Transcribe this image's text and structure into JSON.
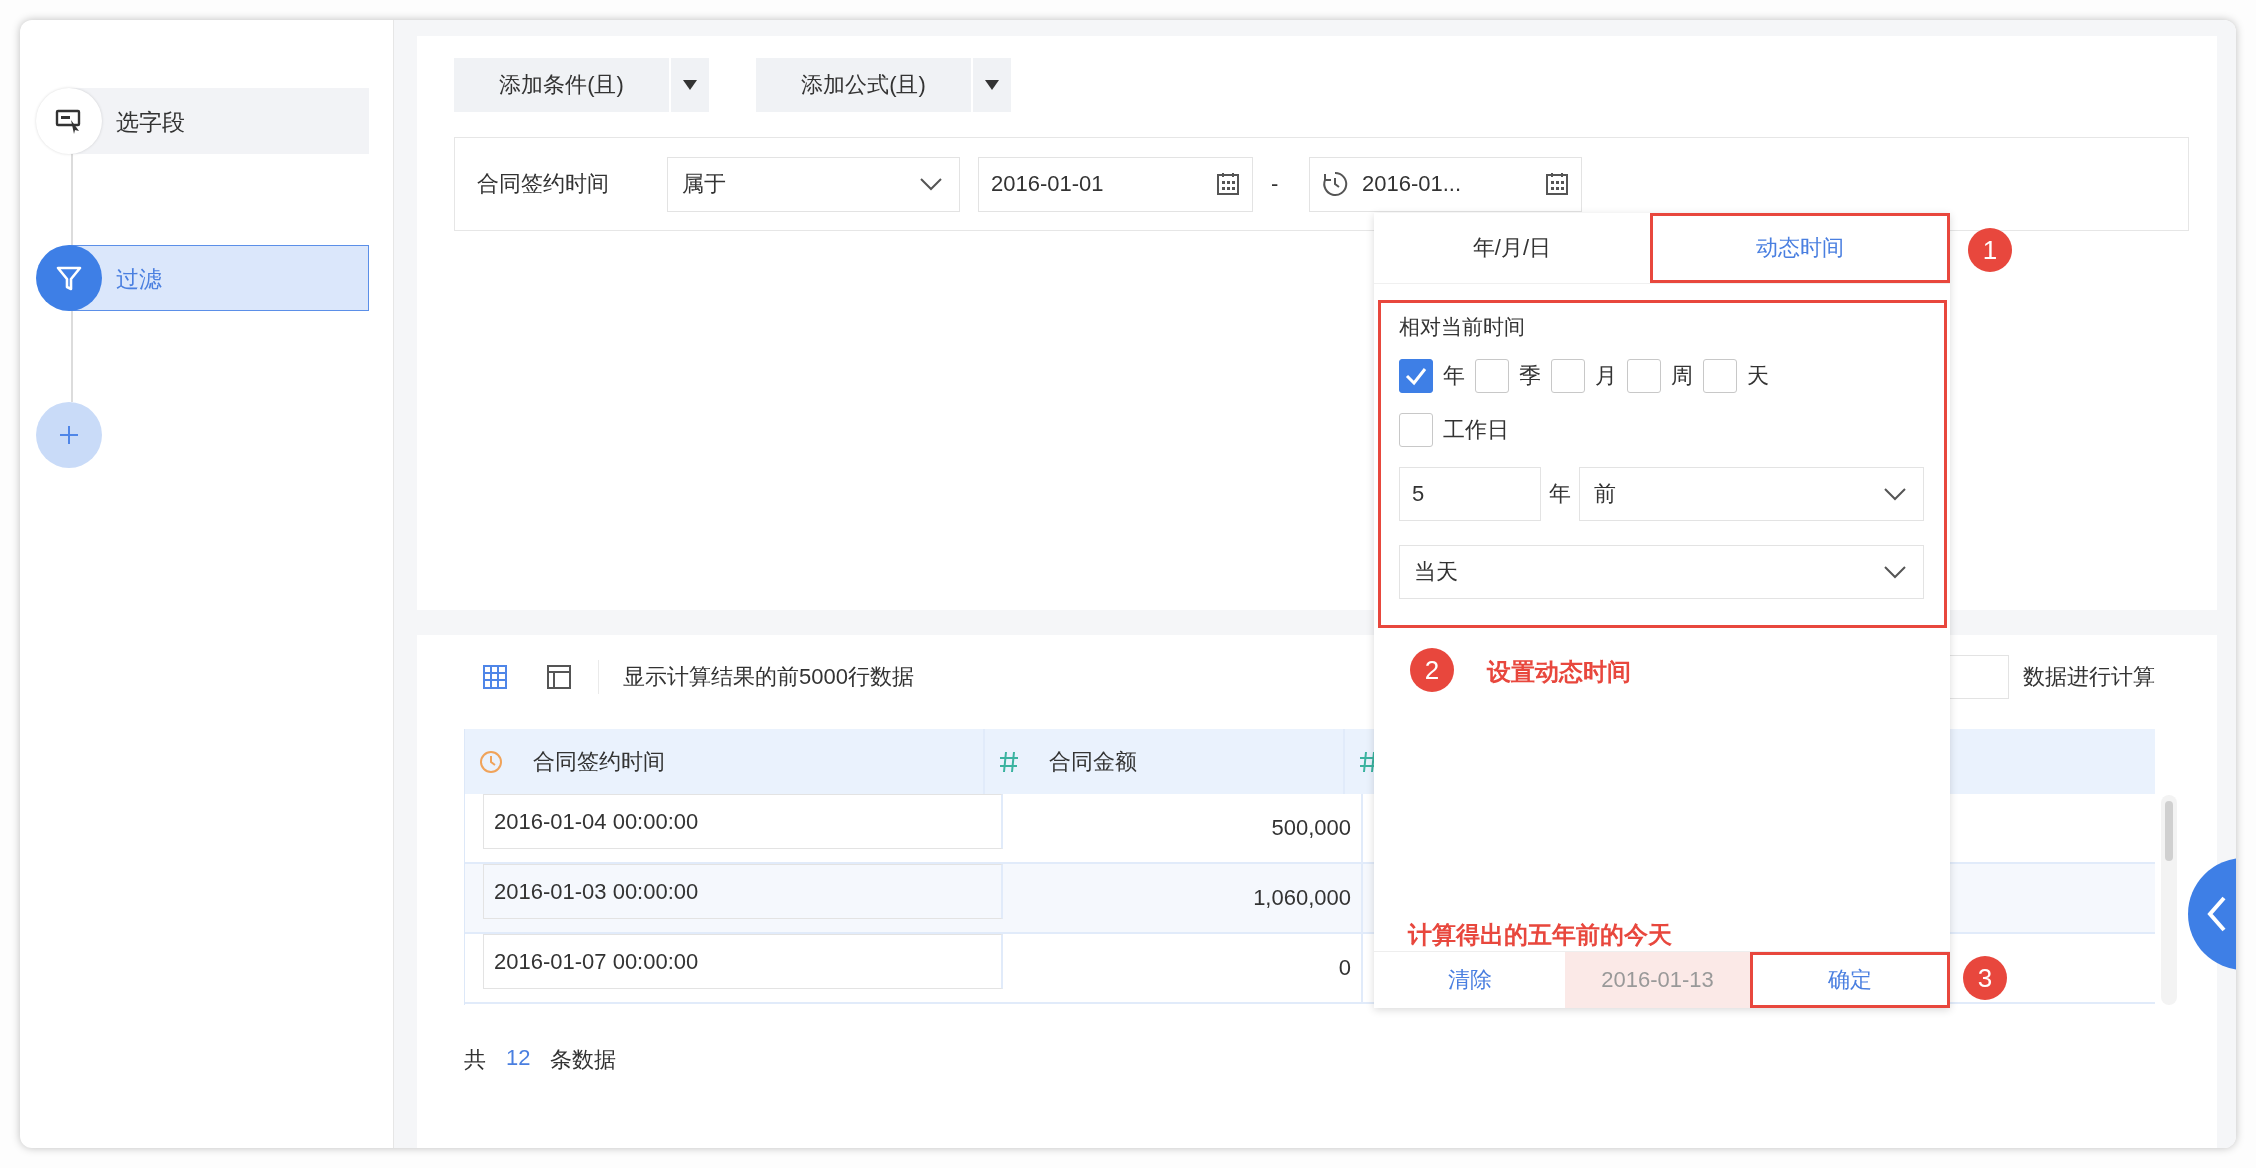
{
  "sidebar": {
    "steps": [
      {
        "label": "选字段",
        "kind": "fields",
        "selected": false
      },
      {
        "label": "过滤",
        "kind": "filter",
        "selected": true
      }
    ]
  },
  "toolbar": {
    "buttons": [
      {
        "label": "添加条件(且)"
      },
      {
        "label": "添加公式(且)"
      }
    ]
  },
  "condition": {
    "field": "合同签约时间",
    "operator": "属于",
    "start_date": "2016-01-01",
    "separator": "-",
    "end_date": "2016-01..."
  },
  "date_popup": {
    "tabs": [
      {
        "label": "年/月/日",
        "selected": false
      },
      {
        "label": "动态时间",
        "selected": true,
        "annotated": true
      }
    ],
    "section_annotated": true,
    "section_title": "相对当前时间",
    "units": [
      {
        "label": "年",
        "checked": true
      },
      {
        "label": "季",
        "checked": false
      },
      {
        "label": "月",
        "checked": false
      },
      {
        "label": "周",
        "checked": false
      },
      {
        "label": "天",
        "checked": false
      },
      {
        "label": "工作日",
        "checked": false
      }
    ],
    "offset": {
      "value": "5",
      "unit": "年",
      "direction": "前"
    },
    "anchor": "当天",
    "footer": {
      "clear": "清除",
      "result": "2016-01-13",
      "confirm": "确定",
      "confirm_annotated": true
    }
  },
  "annotations": {
    "badges": [
      {
        "number": "1"
      },
      {
        "number": "2"
      },
      {
        "number": "3"
      }
    ],
    "notes": [
      "设置动态时间",
      "计算得出的五年前的今天"
    ]
  },
  "preview": {
    "info": "显示计算结果的前5000行数据",
    "calc_label": "数据进行计算",
    "columns": [
      {
        "name": "合同签约时间",
        "kind": "date"
      },
      {
        "name": "合同金额",
        "kind": "number"
      },
      {
        "kind": "number"
      }
    ],
    "rows": [
      {
        "cells": [
          "2016-01-04 00:00:00",
          "500,000"
        ]
      },
      {
        "cells": [
          "2016-01-03 00:00:00",
          "1,060,000"
        ]
      },
      {
        "cells": [
          "2016-01-07 00:00:00",
          "0"
        ]
      }
    ],
    "total": {
      "prefix": "共",
      "count": "12",
      "suffix": "条数据"
    }
  }
}
